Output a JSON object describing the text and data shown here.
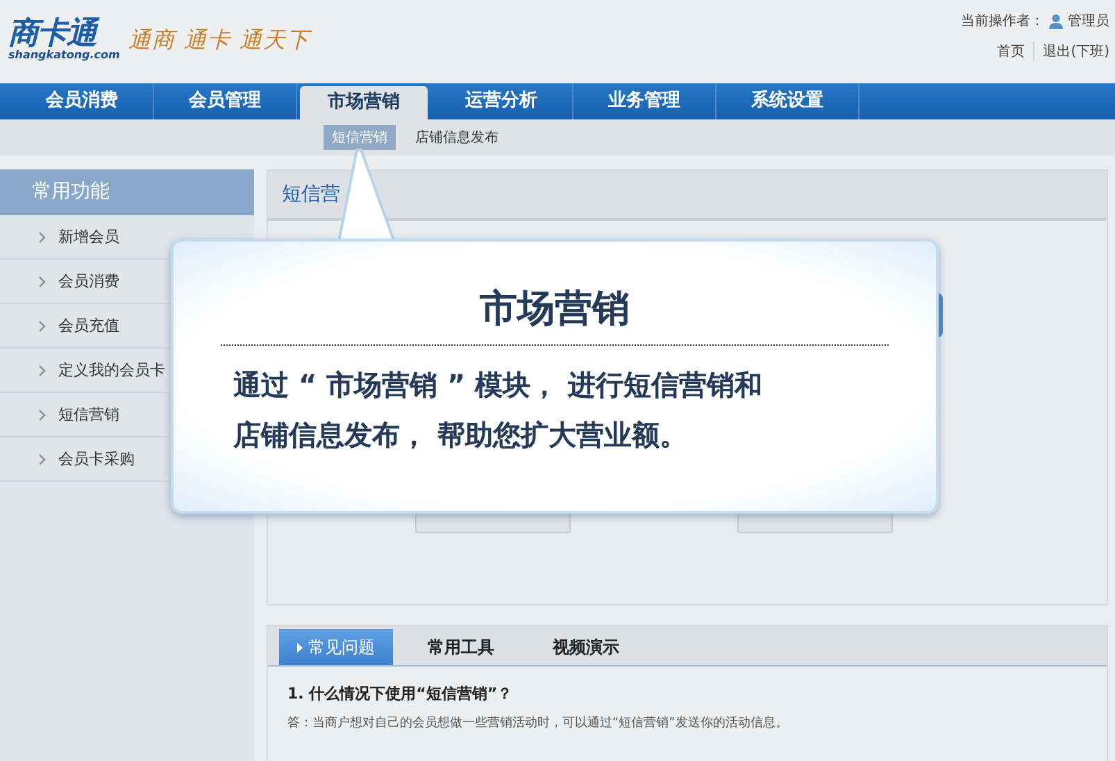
{
  "header": {
    "logo": {
      "name": "商卡通",
      "domain": "shangkatong.com"
    },
    "slogan": "通商 通卡 通天下",
    "operator_label": "当前操作者：",
    "operator": "管理员",
    "links": [
      "首页",
      "退出(下班)"
    ]
  },
  "nav": [
    {
      "label": "会员消费",
      "selected": false
    },
    {
      "label": "会员管理",
      "selected": false
    },
    {
      "label": "市场营销",
      "selected": true
    },
    {
      "label": "运营分析",
      "selected": false
    },
    {
      "label": "业务管理",
      "selected": false
    },
    {
      "label": "系统设置",
      "selected": false
    }
  ],
  "subnav": [
    {
      "label": "短信营销",
      "selected": true
    },
    {
      "label": "店铺信息发布",
      "selected": false
    }
  ],
  "sidebar": {
    "title": "常用功能",
    "items": [
      "新增会员",
      "会员消费",
      "会员充值",
      "定义我的会员卡",
      "短信营销",
      "会员卡采购"
    ]
  },
  "panel": {
    "title": "短信营"
  },
  "callout": {
    "title": "市场营销",
    "lines": [
      "通过 “ 市场营销 ” 模块， 进行短信营销和",
      "店铺信息发布， 帮助您扩大营业额。"
    ]
  },
  "help": {
    "tabs": [
      {
        "label": "常见问题",
        "selected": true
      },
      {
        "label": "常用工具",
        "selected": false
      },
      {
        "label": "视频演示",
        "selected": false
      }
    ],
    "question": "1. 什么情况下使用“短信营销”？",
    "answer": "答：当商户想对自己的会员想做一些营销活动时，可以通过“短信营销”发送你的活动信息。"
  }
}
